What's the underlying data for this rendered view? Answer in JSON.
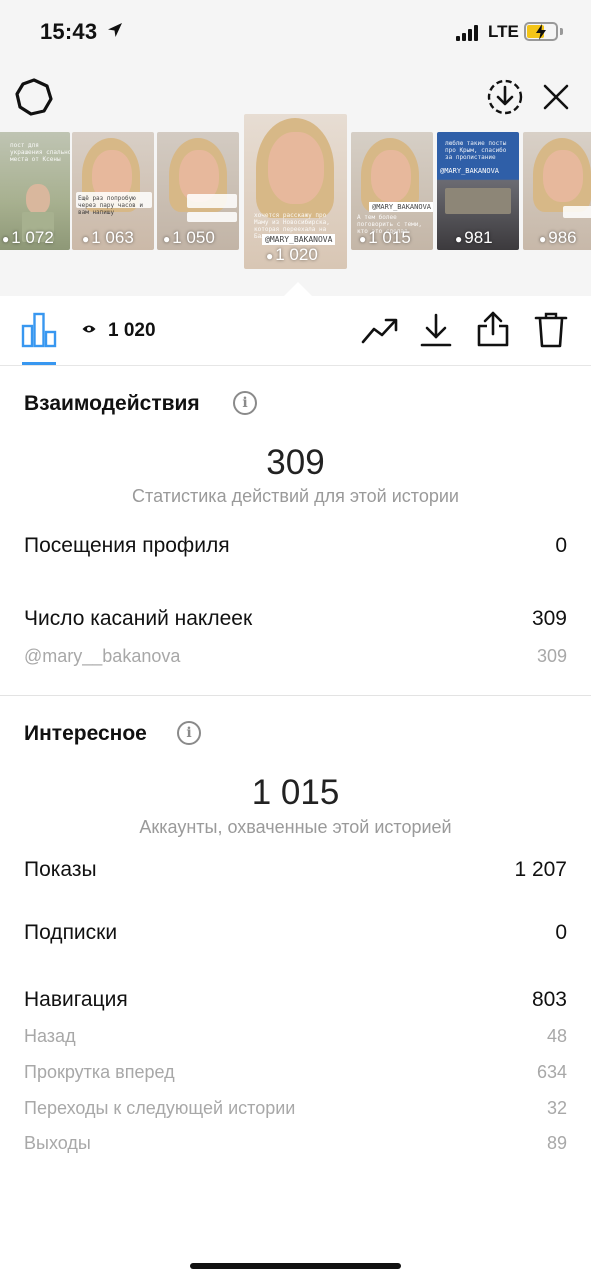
{
  "status_bar": {
    "time": "15:43",
    "network": "LTE",
    "colors": {
      "battery": "#f3c417"
    }
  },
  "header": {
    "icons": [
      "settings-icon",
      "download-circle-icon",
      "close-icon"
    ]
  },
  "stories": [
    {
      "views": "1 072",
      "current": false
    },
    {
      "views": "1 063",
      "current": false
    },
    {
      "views": "1 050",
      "current": false
    },
    {
      "views": "1 020",
      "current": true,
      "tag": "@MARY_BAKANOVA"
    },
    {
      "views": "1 015",
      "current": false,
      "tag": "@MARY_BAKANOVA"
    },
    {
      "views": "981",
      "current": false,
      "tag": "@MARY_BAKANOVA"
    },
    {
      "views": "986",
      "current": false
    }
  ],
  "toolbar": {
    "views": "1 020",
    "accent": "#3897f0",
    "icons": [
      "bar-chart-icon",
      "eye-icon",
      "trend-icon",
      "download-icon",
      "share-icon",
      "trash-icon"
    ]
  },
  "interactions": {
    "title": "Взаимодействия",
    "total": "309",
    "caption": "Статистика действий для этой истории",
    "rows": [
      {
        "label": "Посещения профиля",
        "value": "0"
      },
      {
        "label": "Число касаний наклеек",
        "value": "309"
      }
    ],
    "sub_rows": [
      {
        "label": "@mary__bakanova",
        "value": "309"
      }
    ]
  },
  "discovery": {
    "title": "Интересное",
    "total": "1 015",
    "caption": "Аккаунты, охваченные этой историей",
    "rows": [
      {
        "label": "Показы",
        "value": "1 207"
      },
      {
        "label": "Подписки",
        "value": "0"
      },
      {
        "label": "Навигация",
        "value": "803"
      }
    ],
    "sub_rows": [
      {
        "label": "Назад",
        "value": "48"
      },
      {
        "label": "Прокрутка вперед",
        "value": "634"
      },
      {
        "label": "Переходы к следующей истории",
        "value": "32"
      },
      {
        "label": "Выходы",
        "value": "89"
      }
    ]
  }
}
